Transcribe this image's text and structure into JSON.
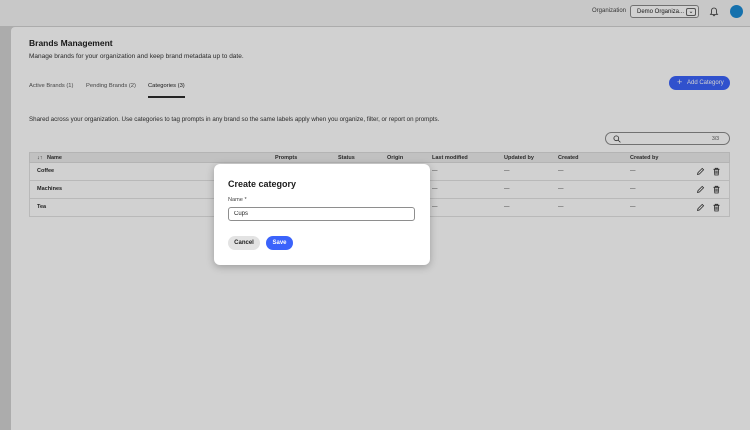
{
  "header": {
    "org_label": "Organization",
    "org_value": "Demo Organiza...",
    "chevron": "chevron-down-icon",
    "bell": "bell-icon",
    "avatar": "user-avatar"
  },
  "page": {
    "title": "Brands Management",
    "subtitle": "Manage brands for your organization and keep brand metadata up to date.",
    "tabs": [
      {
        "label": "Active Brands (1)"
      },
      {
        "label": "Pending Brands (2)"
      },
      {
        "label": "Categories (3)"
      }
    ],
    "active_tab": "Categories (3)",
    "add_button": "Add Category",
    "description": "Shared across your organization. Use categories to tag prompts in any brand so the same labels apply when you organize, filter, or report on prompts.",
    "search": {
      "placeholder": "",
      "count": "3/3"
    }
  },
  "table": {
    "columns": [
      "Name",
      "Prompts",
      "Status",
      "Origin",
      "Last modified",
      "Updated by",
      "Created",
      "Created by"
    ],
    "rows": [
      {
        "name": "Coffee",
        "last_modified": "—",
        "updated_by": "—",
        "created": "—",
        "created_by": "—"
      },
      {
        "name": "Machines",
        "last_modified": "—",
        "updated_by": "—",
        "created": "—",
        "created_by": "—"
      },
      {
        "name": "Tea",
        "last_modified": "—",
        "updated_by": "—",
        "created": "—",
        "created_by": "—"
      }
    ]
  },
  "dialog": {
    "title": "Create category",
    "name_label": "Name",
    "required_marker": "*",
    "name_value": "Cups",
    "cancel_label": "Cancel",
    "save_label": "Save"
  },
  "colors": {
    "accent": "#3b63fb",
    "avatar": "#1a8ad4"
  }
}
